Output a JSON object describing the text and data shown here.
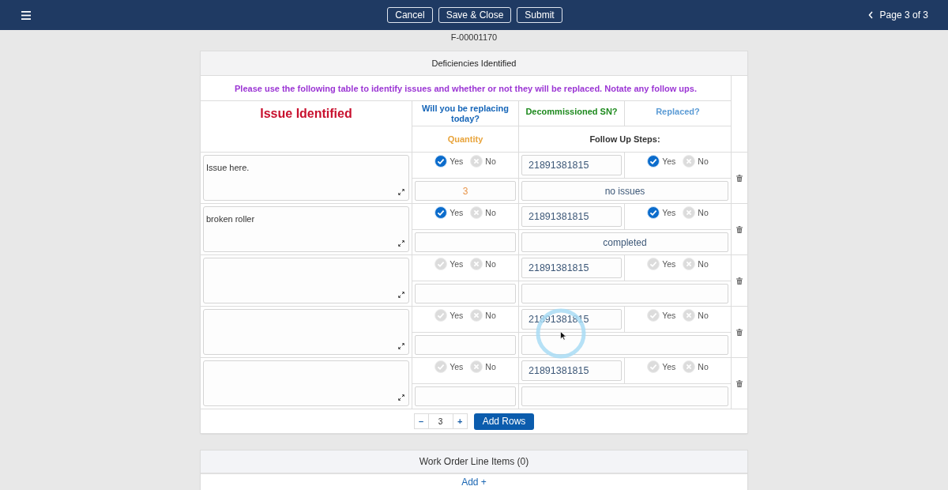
{
  "top_bar": {
    "buttons": [
      "Cancel",
      "Save & Close",
      "Submit"
    ],
    "page_label": "Page 3 of 3"
  },
  "record_id": "F-00001170",
  "deficiencies": {
    "title": "Deficiencies Identified",
    "instruction": "Please use the following table to identify issues and whether or not they will be replaced. Notate any follow ups.",
    "columns": [
      {
        "label": "Issue Identified",
        "color": "#c8102e"
      },
      {
        "label": "Will you be replacing today?",
        "color": "#1565b8"
      },
      {
        "label": "Decommissioned SN?",
        "color": "#1e8a1e"
      },
      {
        "label": "Replaced?",
        "color": "#5b9bd5"
      },
      {
        "label": "Quantity",
        "color": "#e8a33a"
      },
      {
        "label": "Follow Up Steps:",
        "color": "#333333"
      }
    ],
    "rows": [
      {
        "issue": "Issue here.",
        "replacing": [
          {
            "label": "Yes",
            "kind": "check",
            "selected": true
          },
          {
            "label": "No",
            "kind": "cross",
            "selected": false
          }
        ],
        "serial": "21891381815",
        "replaced": [
          {
            "label": "Yes",
            "kind": "check",
            "selected": true
          },
          {
            "label": "No",
            "kind": "cross",
            "selected": false
          }
        ],
        "quantity": "3",
        "follow_up": "no issues"
      },
      {
        "issue": "broken roller",
        "replacing": [
          {
            "label": "Yes",
            "kind": "check",
            "selected": true
          },
          {
            "label": "No",
            "kind": "cross",
            "selected": false
          }
        ],
        "serial": "21891381815",
        "replaced": [
          {
            "label": "Yes",
            "kind": "check",
            "selected": true
          },
          {
            "label": "No",
            "kind": "cross",
            "selected": false
          }
        ],
        "follow_up": "completed"
      },
      {
        "replacing": [
          {
            "label": "Yes",
            "kind": "check",
            "selected": false
          },
          {
            "label": "No",
            "kind": "cross",
            "selected": false
          }
        ],
        "serial": "21891381815",
        "replaced": [
          {
            "label": "Yes",
            "kind": "check",
            "selected": false
          },
          {
            "label": "No",
            "kind": "cross",
            "selected": false
          }
        ]
      },
      {
        "replacing": [
          {
            "label": "Yes",
            "kind": "check",
            "selected": false
          },
          {
            "label": "No",
            "kind": "cross",
            "selected": false
          }
        ],
        "serial": "21891381815",
        "replaced": [
          {
            "label": "Yes",
            "kind": "check",
            "selected": false
          },
          {
            "label": "No",
            "kind": "cross",
            "selected": false
          }
        ]
      },
      {
        "replacing": [
          {
            "label": "Yes",
            "kind": "check",
            "selected": false
          },
          {
            "label": "No",
            "kind": "cross",
            "selected": false
          }
        ],
        "serial": "21891381815",
        "replaced": [
          {
            "label": "Yes",
            "kind": "check",
            "selected": false
          },
          {
            "label": "No",
            "kind": "cross",
            "selected": false
          }
        ]
      }
    ],
    "row_count": {
      "decrement": "–",
      "value": "3",
      "increment": "+"
    },
    "add_button": "Add Rows"
  },
  "work_order_items": {
    "title": "Work Order Line Items (0)",
    "add_link": "Add +"
  }
}
